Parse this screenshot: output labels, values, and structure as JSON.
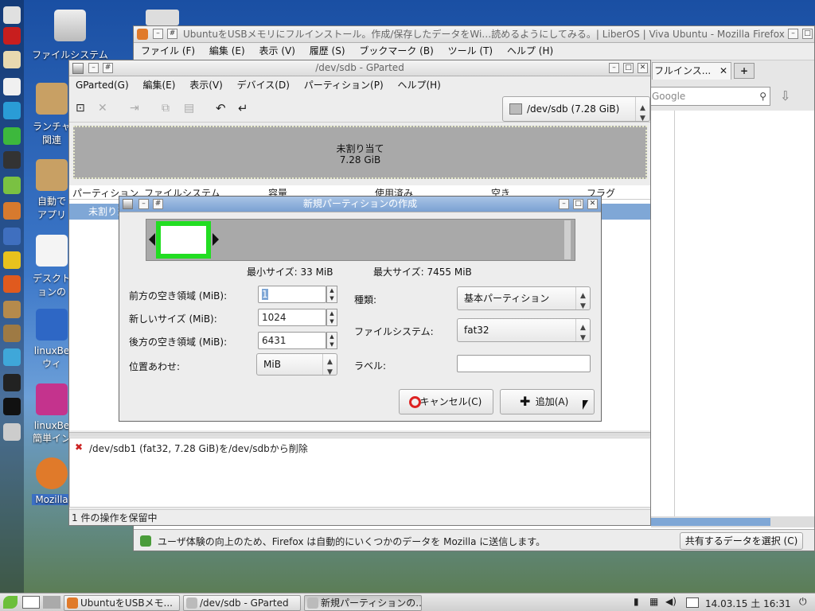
{
  "desktop": {
    "icons": [
      {
        "label": "ファイルシステム"
      },
      {
        "label": "ランチャ"
      },
      {
        "label": "関連"
      },
      {
        "label": "自動で"
      },
      {
        "label": "アプリ"
      },
      {
        "label": "デスクト"
      },
      {
        "label": "ョンの"
      },
      {
        "label": "linuxBe"
      },
      {
        "label": "ウィ"
      },
      {
        "label": "linuxBe"
      },
      {
        "label": "簡単イン"
      },
      {
        "label": "Mozilla"
      }
    ]
  },
  "firefox": {
    "title": "UbuntuをUSBメモリにフルインストール。作成/保存したデータをWi…読めるようにしてみる。| LiberOS | Viva Ubuntu - Mozilla Firefox",
    "menu": [
      "ファイル (F)",
      "編集 (E)",
      "表示 (V)",
      "履歴 (S)",
      "ブックマーク (B)",
      "ツール (T)",
      "ヘルプ (H)"
    ],
    "tab_label": "フルインス...",
    "search_placeholder": "Google",
    "notice": "ユーザ体験の向上のため、Firefox は自動的にいくつかのデータを Mozilla に送信します。",
    "notice_button": "共有するデータを選択 (C)"
  },
  "gparted": {
    "title": "/dev/sdb - GParted",
    "menu": [
      "GParted(G)",
      "編集(E)",
      "表示(V)",
      "デバイス(D)",
      "パーティション(P)",
      "ヘルプ(H)"
    ],
    "device_selector": "/dev/sdb   (7.28 GiB)",
    "unallocated_label": "未割り当て",
    "unallocated_size": "7.28 GiB",
    "columns": [
      "パーティション",
      "ファイルシステム",
      "容量",
      "使用済み",
      "空き",
      "フラグ"
    ],
    "row_first": "未割り当",
    "pending_op": "/dev/sdb1 (fat32, 7.28 GiB)を/dev/sdbから削除",
    "status": "1 件の操作を保留中"
  },
  "dialog": {
    "title": "新規パーティションの作成",
    "min_size": "最小サイズ: 33 MiB",
    "max_size": "最大サイズ: 7455 MiB",
    "free_before_label": "前方の空き領域 (MiB):",
    "free_before_value": "1",
    "new_size_label": "新しいサイズ (MiB):",
    "new_size_value": "1024",
    "free_after_label": "後方の空き領域 (MiB):",
    "free_after_value": "6431",
    "align_label": "位置あわせ:",
    "align_value": "MiB",
    "type_label": "種類:",
    "type_value": "基本パーティション",
    "fs_label": "ファイルシステム:",
    "fs_value": "fat32",
    "name_label": "ラベル:",
    "name_value": "",
    "cancel": "キャンセル(C)",
    "add": "追加(A)",
    "partition_fraction": 0.135,
    "partition_color": "#22dd22"
  },
  "taskbar": {
    "tasks": [
      "UbuntuをUSBメモ...",
      "/dev/sdb - GParted",
      "新規パーティションの..."
    ],
    "clock": "14.03.15 土 16:31"
  }
}
